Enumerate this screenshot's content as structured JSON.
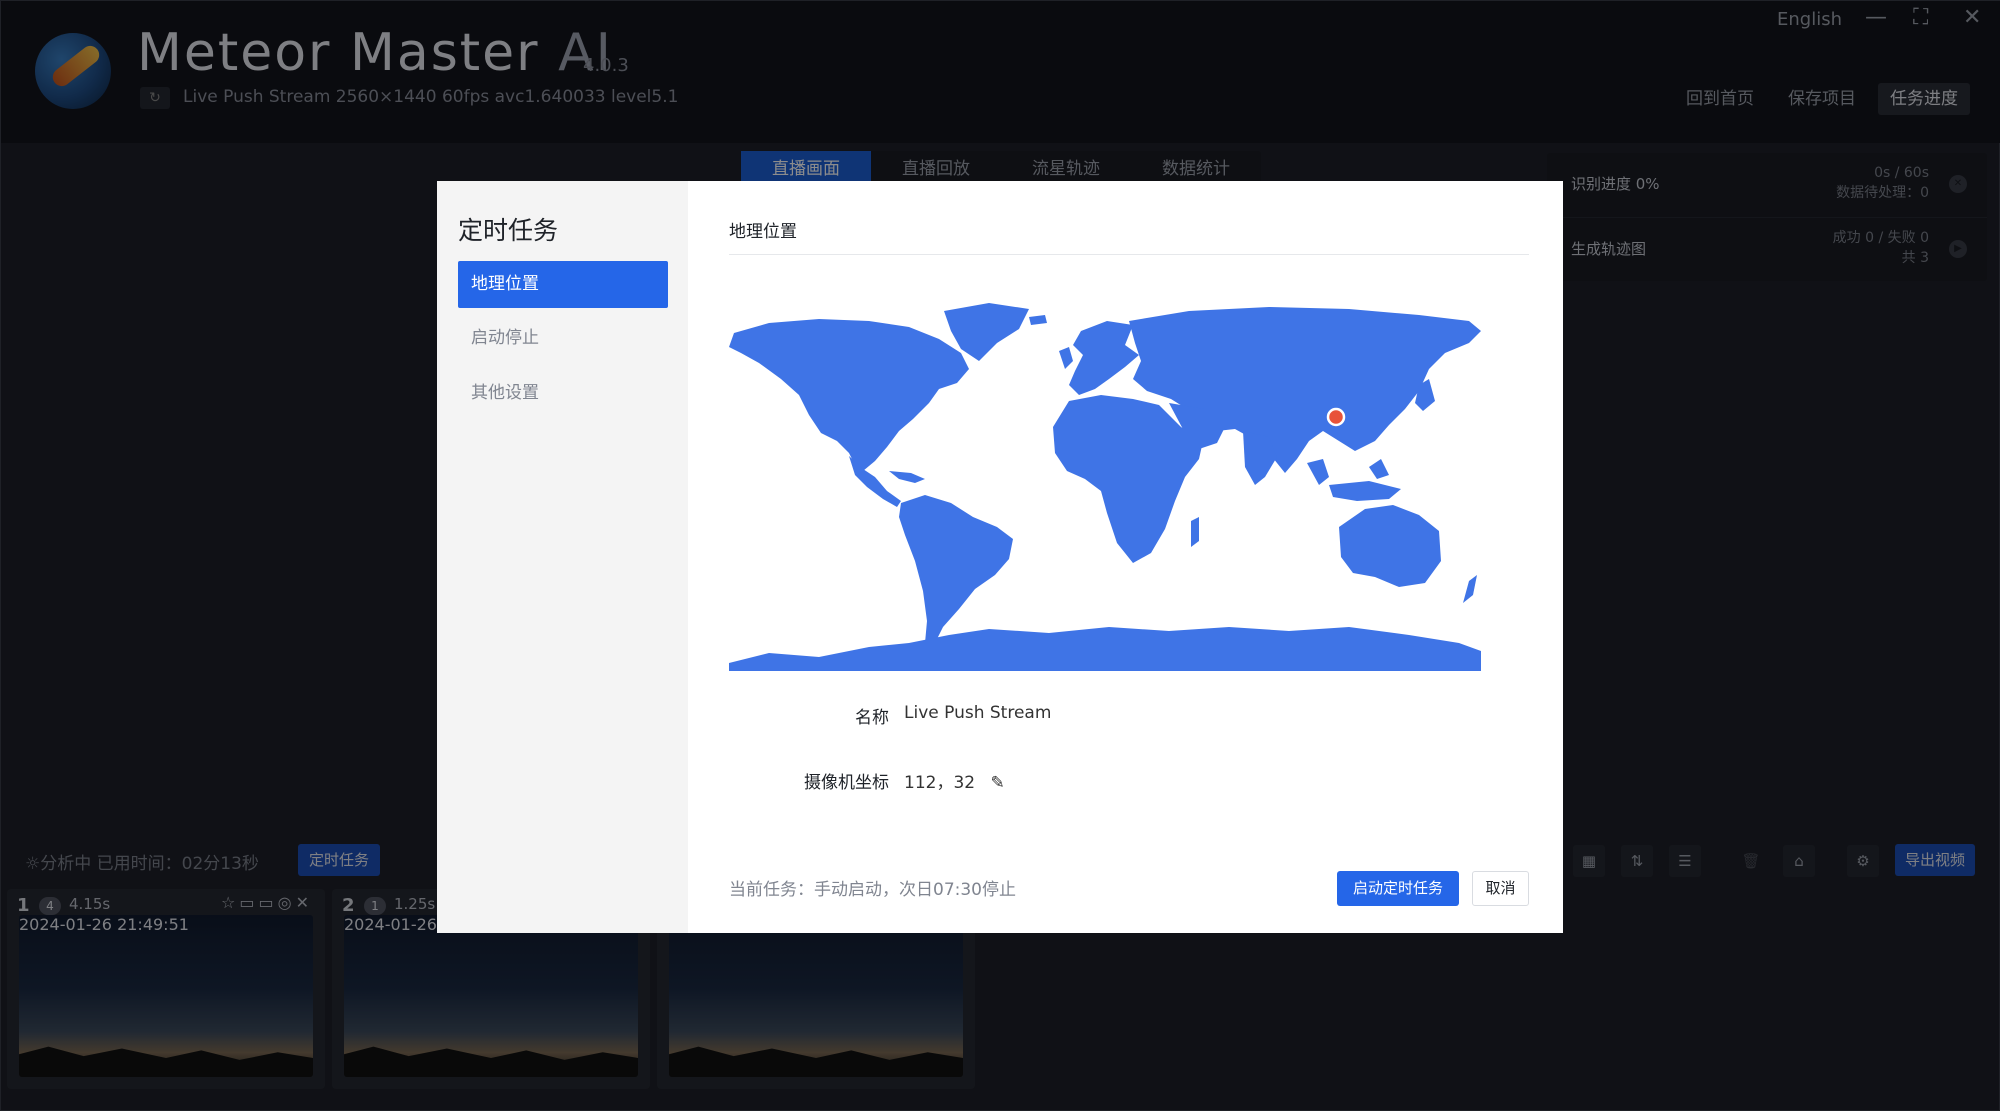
{
  "app": {
    "title": "Meteor Master",
    "title_suffix": "AI",
    "version": "4.0.3",
    "reload_icon": "↻",
    "stream_info": "Live Push Stream 2560×1440 60fps avc1.640033 level5.1"
  },
  "window": {
    "language": "English",
    "minimize": "—",
    "maximize": "⛶",
    "close": "✕"
  },
  "nav": {
    "home": "回到首页",
    "save": "保存项目",
    "progress": "任务进度"
  },
  "tabs": [
    {
      "label": "直播画面",
      "active": true
    },
    {
      "label": "直播回放",
      "active": false
    },
    {
      "label": "流星轨迹",
      "active": false
    },
    {
      "label": "数据统计",
      "active": false
    }
  ],
  "right_panel": {
    "recognition": {
      "label": "识别进度 0%",
      "time": "0s / 60s",
      "pending": "数据待处理：0"
    },
    "trajectory": {
      "label": "生成轨迹图",
      "result": "成功 0 / 失败 0",
      "total": "共 3"
    }
  },
  "status_bar": {
    "status": "☼分析中 已用时间：02分13秒",
    "timer_button": "定时任务",
    "export_button": "导出视频",
    "icons": [
      "calendar-icon",
      "sort-icon",
      "list-icon",
      "trash-icon",
      "basket-icon",
      "gear-icon"
    ]
  },
  "thumbnails": [
    {
      "index": "1",
      "count": "4",
      "duration": "4.15s",
      "timestamp": "2024-01-26 21:49:51",
      "actions": "☆▭▭◎✕"
    },
    {
      "index": "2",
      "count": "1",
      "duration": "1.25s",
      "timestamp": "2024-01-26",
      "actions": ""
    },
    {
      "index": "",
      "count": "",
      "duration": "",
      "timestamp": "",
      "actions": ""
    }
  ],
  "modal": {
    "title": "定时任务",
    "menu": [
      {
        "label": "地理位置",
        "active": true
      },
      {
        "label": "启动停止",
        "active": false
      },
      {
        "label": "其他设置",
        "active": false
      }
    ],
    "section_title": "地理位置",
    "name_label": "名称",
    "name_value": "Live Push Stream",
    "coord_label": "摄像机坐标",
    "coord_value": "112，32",
    "edit_icon": "✎",
    "current_task": "当前任务：手动启动，次日07:30停止",
    "start_button": "启动定时任务",
    "cancel_button": "取消"
  },
  "colors": {
    "accent": "#2566e8",
    "map_land": "#3f74e6",
    "marker": "#e8533a",
    "dark_bg": "#1e2029"
  }
}
